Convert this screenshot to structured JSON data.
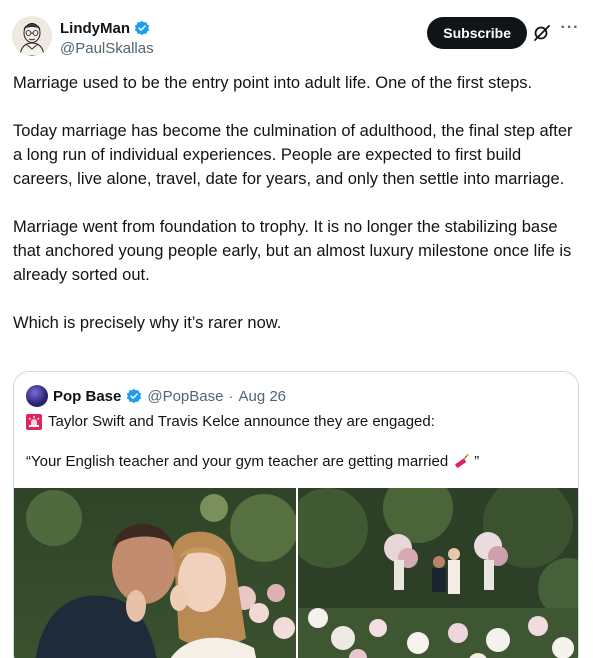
{
  "post": {
    "author_name": "LindyMan",
    "author_handle": "@PaulSkallas",
    "verified_icon": "verified-badge-icon",
    "subscribe_label": "Subscribe",
    "more_icon_text": "···",
    "paragraphs": [
      "Marriage used to be the entry point into adult life. One of the first steps.",
      "Today marriage has become the culmination of adulthood, the final step after a long run of individual experiences. People are expected to first build careers, live alone, travel, date for years, and only then settle into marriage.",
      "Marriage went from foundation to trophy. It is no longer the stabilizing base that anchored young people early, but an almost luxury milestone once life is already sorted out.",
      "Which is precisely why it’s rarer now."
    ]
  },
  "quote": {
    "author_name": "Pop Base",
    "author_handle": "@PopBase",
    "separator": "·",
    "date": "Aug 26",
    "line1": "Taylor Swift and Travis Kelce announce they are engaged:",
    "line2": "“Your English teacher and your gym teacher are getting married",
    "line2_end": "”",
    "icons": [
      "siren-icon",
      "firecracker-icon"
    ],
    "photos": [
      "couple-closeup-photo",
      "garden-proposal-photo"
    ]
  },
  "colors": {
    "text": "#0f1419",
    "secondary": "#536471",
    "verified": "#1d9bf0",
    "border": "#cfd9de",
    "subscribe_bg": "#0f1419"
  }
}
